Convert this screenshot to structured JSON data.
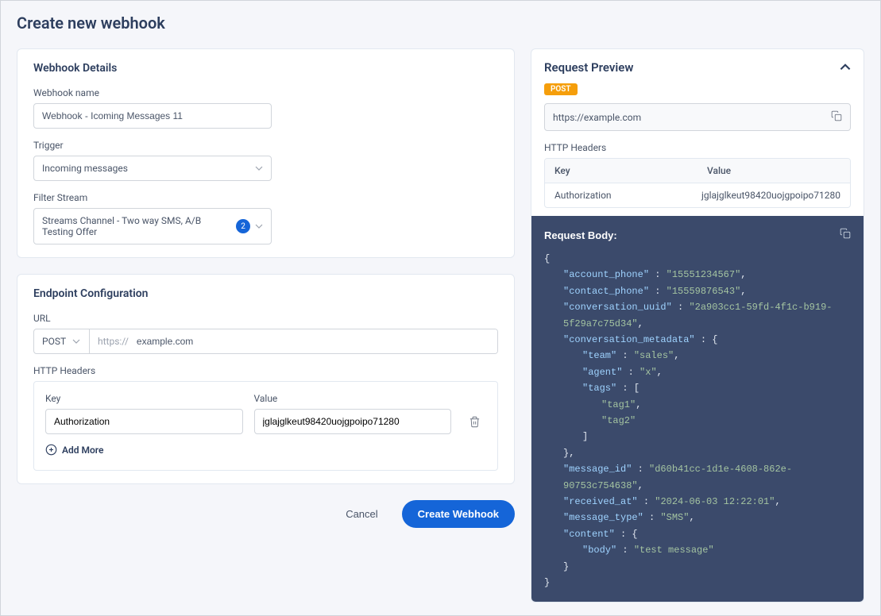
{
  "page": {
    "title": "Create new webhook"
  },
  "details": {
    "section_title": "Webhook Details",
    "name_label": "Webhook name",
    "name_value": "Webhook - Icoming Messages 11",
    "trigger_label": "Trigger",
    "trigger_value": "Incoming messages",
    "filter_label": "Filter Stream",
    "filter_value": "Streams Channel - Two way SMS, A/B Testing Offer",
    "filter_badge": "2"
  },
  "endpoint": {
    "section_title": "Endpoint Configuration",
    "url_label": "URL",
    "method": "POST",
    "url_prefix": "https://",
    "url_value": "example.com",
    "headers_label": "HTTP Headers",
    "key_label": "Key",
    "value_label": "Value",
    "header_key": "Authorization",
    "header_value": "jglajglkeut98420uojgpoipo71280",
    "add_more": "Add More"
  },
  "actions": {
    "cancel": "Cancel",
    "submit": "Create Webhook"
  },
  "preview": {
    "title": "Request Preview",
    "method_badge": "POST",
    "url": "https://example.com",
    "headers_label": "HTTP Headers",
    "key_label": "Key",
    "value_label": "Value",
    "header_key": "Authorization",
    "header_value": "jglajglkeut98420uojgpoipo71280",
    "body_label": "Request Body:",
    "body": {
      "account_phone": "15551234567",
      "contact_phone": "15559876543",
      "conversation_uuid": "2a903cc1-59fd-4f1c-b919-5f29a7c75d34",
      "conversation_metadata": {
        "team": "sales",
        "agent": "x",
        "tags": [
          "tag1",
          "tag2"
        ]
      },
      "message_id": "d60b41cc-1d1e-4608-862e-90753c754638",
      "received_at": "2024-06-03 12:22:01",
      "message_type": "SMS",
      "content": {
        "body": "test message"
      }
    }
  }
}
